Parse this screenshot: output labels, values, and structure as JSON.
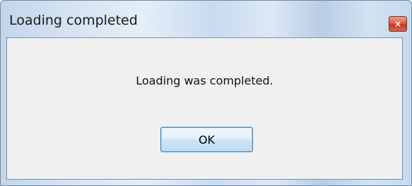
{
  "window": {
    "title": "Loading completed",
    "close_icon": "×"
  },
  "dialog": {
    "message": "Loading was completed.",
    "ok_label": "OK"
  },
  "icons": {
    "close": "close-icon"
  },
  "colors": {
    "close_button": "#c7432b",
    "ok_button_border": "#3c7fb1",
    "content_background": "#f0f0f0"
  }
}
